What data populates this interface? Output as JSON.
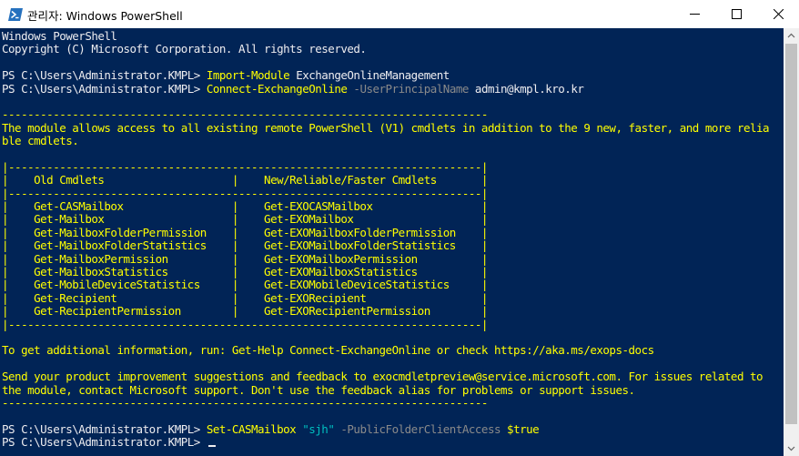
{
  "window": {
    "title": "관리자: Windows PowerShell",
    "accent": "#012456",
    "icons": {
      "app": "powershell-icon",
      "minimize": "minimize-icon",
      "maximize": "maximize-icon",
      "close": "close-icon"
    }
  },
  "console": {
    "colors": {
      "background": "#012456",
      "text": "#eeedf0",
      "warning": "#ffff00",
      "command": "#ffff00",
      "string": "#00c0c0",
      "parameter": "#8a8a8a"
    },
    "lines": [
      [
        {
          "t": "Windows PowerShell",
          "s": "w"
        }
      ],
      [
        {
          "t": "Copyright (C) Microsoft Corporation. All rights reserved.",
          "s": "w"
        }
      ],
      [
        {
          "t": "",
          "s": "w"
        }
      ],
      [
        {
          "t": "PS C:\\Users\\Administrator.KMPL> ",
          "s": "w"
        },
        {
          "t": "Import-Module",
          "s": "y"
        },
        {
          "t": " ExchangeOnlineManagement",
          "s": "w"
        }
      ],
      [
        {
          "t": "PS C:\\Users\\Administrator.KMPL> ",
          "s": "w"
        },
        {
          "t": "Connect-ExchangeOnline",
          "s": "y"
        },
        {
          "t": " -UserPrincipalName",
          "s": "g"
        },
        {
          "t": " admin@kmpl.kro.kr",
          "s": "w"
        }
      ],
      [
        {
          "t": "",
          "s": "w"
        }
      ],
      [
        {
          "t": "----------------------------------------------------------------------------",
          "s": "y"
        }
      ],
      [
        {
          "t": "The module allows access to all existing remote PowerShell (V1) cmdlets in addition to the 9 new, faster, and more relia",
          "s": "y"
        }
      ],
      [
        {
          "t": "ble cmdlets.",
          "s": "y"
        }
      ],
      [
        {
          "t": "",
          "s": "y"
        }
      ],
      [
        {
          "t": "|--------------------------------------------------------------------------|",
          "s": "y"
        }
      ],
      [
        {
          "t": "|    Old Cmdlets                    |    New/Reliable/Faster Cmdlets       |",
          "s": "y"
        }
      ],
      [
        {
          "t": "|--------------------------------------------------------------------------|",
          "s": "y"
        }
      ],
      [
        {
          "t": "|    Get-CASMailbox                 |    Get-EXOCASMailbox                 |",
          "s": "y"
        }
      ],
      [
        {
          "t": "|    Get-Mailbox                    |    Get-EXOMailbox                    |",
          "s": "y"
        }
      ],
      [
        {
          "t": "|    Get-MailboxFolderPermission    |    Get-EXOMailboxFolderPermission    |",
          "s": "y"
        }
      ],
      [
        {
          "t": "|    Get-MailboxFolderStatistics    |    Get-EXOMailboxFolderStatistics    |",
          "s": "y"
        }
      ],
      [
        {
          "t": "|    Get-MailboxPermission          |    Get-EXOMailboxPermission          |",
          "s": "y"
        }
      ],
      [
        {
          "t": "|    Get-MailboxStatistics          |    Get-EXOMailboxStatistics          |",
          "s": "y"
        }
      ],
      [
        {
          "t": "|    Get-MobileDeviceStatistics     |    Get-EXOMobileDeviceStatistics     |",
          "s": "y"
        }
      ],
      [
        {
          "t": "|    Get-Recipient                  |    Get-EXORecipient                  |",
          "s": "y"
        }
      ],
      [
        {
          "t": "|    Get-RecipientPermission        |    Get-EXORecipientPermission        |",
          "s": "y"
        }
      ],
      [
        {
          "t": "|--------------------------------------------------------------------------|",
          "s": "y"
        }
      ],
      [
        {
          "t": "",
          "s": "y"
        }
      ],
      [
        {
          "t": "To get additional information, run: Get-Help Connect-ExchangeOnline or check https://aka.ms/exops-docs",
          "s": "y"
        }
      ],
      [
        {
          "t": "",
          "s": "y"
        }
      ],
      [
        {
          "t": "Send your product improvement suggestions and feedback to exocmdletpreview@service.microsoft.com. For issues related to",
          "s": "y"
        }
      ],
      [
        {
          "t": "the module, contact Microsoft support. Don't use the feedback alias for problems or support issues.",
          "s": "y"
        }
      ],
      [
        {
          "t": "----------------------------------------------------------------------------",
          "s": "y"
        }
      ],
      [
        {
          "t": "",
          "s": "w"
        }
      ],
      [
        {
          "t": "PS C:\\Users\\Administrator.KMPL> ",
          "s": "w"
        },
        {
          "t": "Set-CASMailbox",
          "s": "y"
        },
        {
          "t": " \"sjh\"",
          "s": "c"
        },
        {
          "t": " -PublicFolderClientAccess",
          "s": "g"
        },
        {
          "t": " $true",
          "s": "y"
        }
      ],
      [
        {
          "t": "PS C:\\Users\\Administrator.KMPL> ",
          "s": "w"
        }
      ]
    ]
  }
}
